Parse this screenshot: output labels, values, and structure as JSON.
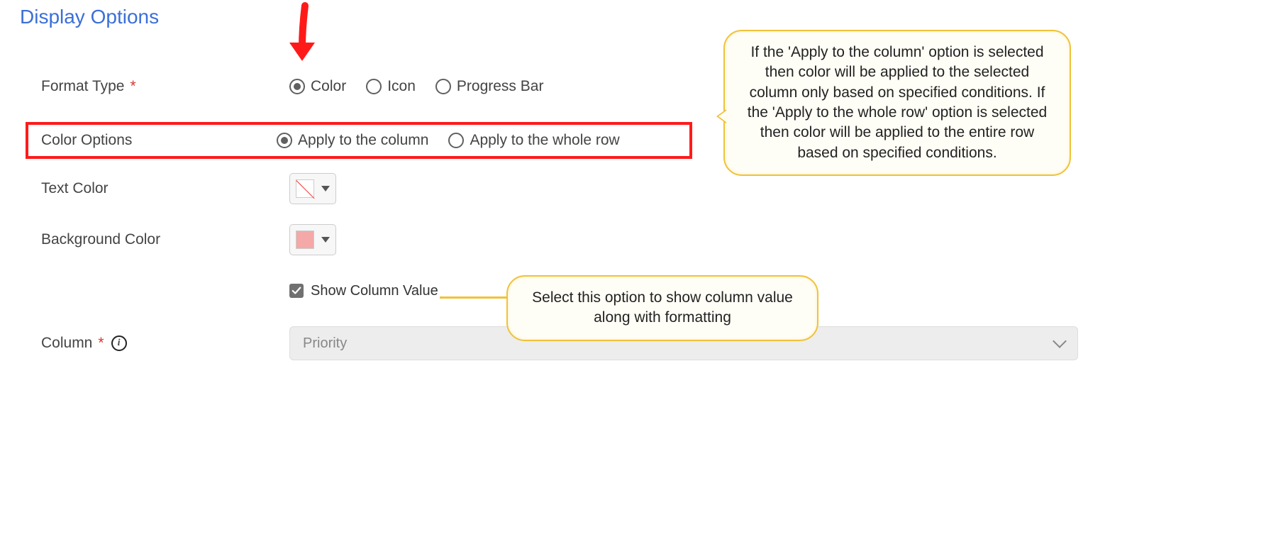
{
  "section_title": "Display Options",
  "labels": {
    "format_type": "Format Type",
    "color_options": "Color Options",
    "text_color": "Text Color",
    "background_color": "Background Color",
    "column": "Column"
  },
  "format_type": {
    "color": "Color",
    "icon": "Icon",
    "progress_bar": "Progress Bar"
  },
  "color_options": {
    "apply_column": "Apply to the column",
    "apply_row": "Apply to the whole row"
  },
  "checkbox": {
    "show_column_value": "Show Column Value"
  },
  "column_select": {
    "value": "Priority"
  },
  "callouts": {
    "main": "If the 'Apply to the column' option is selected then color will be applied to the selected column only based on specified conditions. If the 'Apply to the whole row' option is selected then color will be applied to the entire row based on specified conditions.",
    "check": "Select this option to show column value along with formatting"
  },
  "info_glyph": "i"
}
